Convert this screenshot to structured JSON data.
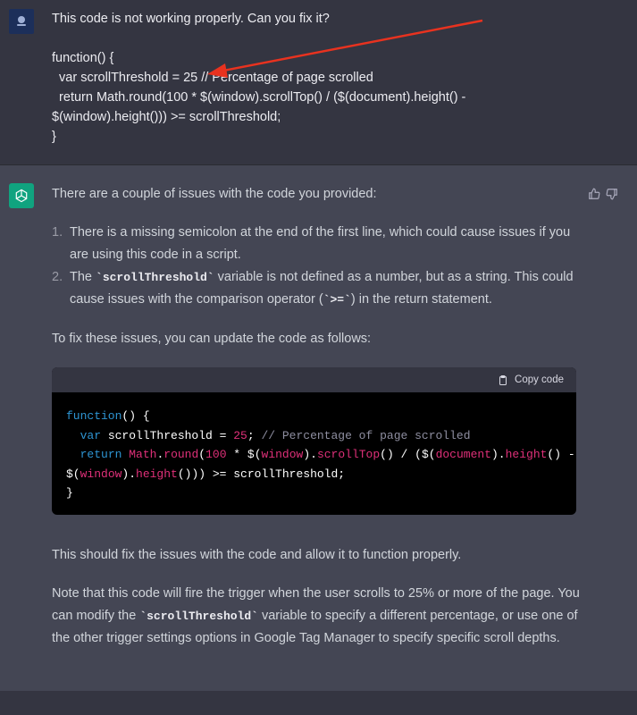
{
  "user": {
    "avatar_icon": "user-avatar-icon",
    "line1": "This code is not working properly. Can you fix it?",
    "code_lines": [
      "function() {",
      "  var scrollThreshold = 25 // Percentage of page scrolled",
      "  return Math.round(100 * $(window).scrollTop() / ($(document).height() -",
      "$(window).height())) >= scrollThreshold;",
      "}"
    ]
  },
  "assistant": {
    "avatar_icon": "openai-logo-icon",
    "intro": "There are a couple of issues with the code you provided:",
    "issues": [
      {
        "num": "1.",
        "text": "There is a missing semicolon at the end of the first line, which could cause issues if you are using this code in a script."
      },
      {
        "num": "2.",
        "pre": "The ",
        "code": "`scrollThreshold`",
        "post": " variable is not defined as a number, but as a string. This could cause issues with the comparison operator (",
        "code2": "`>=`",
        "post2": ") in the return statement."
      }
    ],
    "fix_intro": "To fix these issues, you can update the code as follows:",
    "copy_label": "Copy code",
    "outro1": "This should fix the issues with the code and allow it to function properly.",
    "outro2_a": "Note that this code will fire the trigger when the user scrolls to 25% or more of the page. You can modify the ",
    "outro2_code": "`scrollThreshold`",
    "outro2_b": " variable to specify a different percentage, or use one of the other trigger settings options in Google Tag Manager to specify specific scroll depths."
  },
  "colors": {
    "user_bg": "#343541",
    "assistant_bg": "#444654",
    "brand_green": "#10a37f",
    "arrow_red": "#e8321f"
  }
}
